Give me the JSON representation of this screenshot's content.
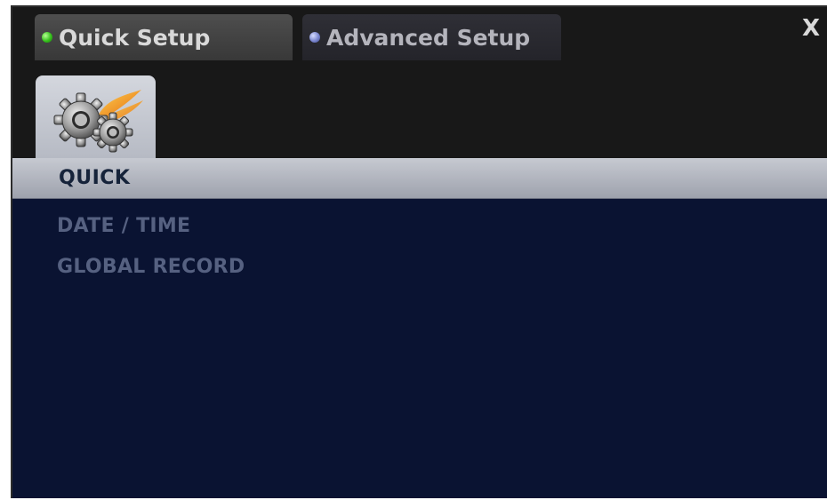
{
  "tabs": [
    {
      "label": "Quick Setup",
      "indicator": "green-dot",
      "active": true
    },
    {
      "label": "Advanced Setup",
      "indicator": "blue-dot",
      "active": false
    }
  ],
  "close_label": "X",
  "icon_tab": {
    "icon": "gears-icon"
  },
  "section": {
    "title": "QUICK"
  },
  "menu": {
    "items": [
      {
        "label": "DATE / TIME"
      },
      {
        "label": "GLOBAL RECORD"
      }
    ]
  },
  "colors": {
    "frame": "#181818",
    "content": "#0a1332",
    "menu_text": "#566181",
    "section_bar": "#b7bac3"
  }
}
